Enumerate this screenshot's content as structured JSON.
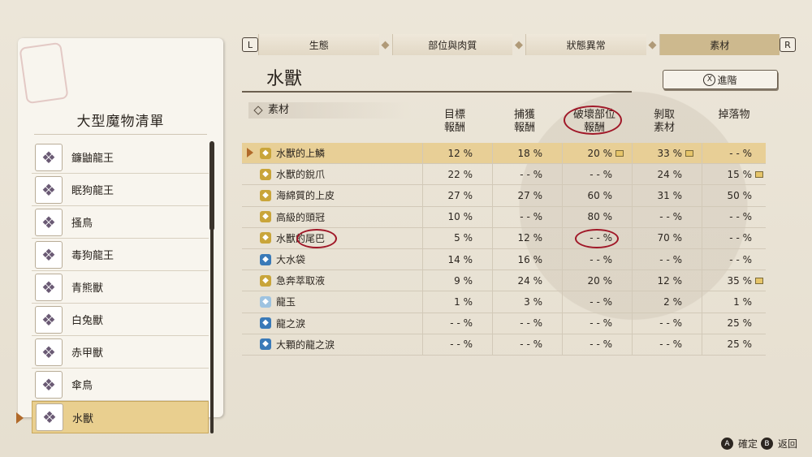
{
  "left_panel": {
    "title": "大型魔物清單",
    "monsters": [
      {
        "name": "鐮鼬龍王",
        "icon": "monster-portrait-icon"
      },
      {
        "name": "眠狗龍王",
        "icon": "monster-portrait-icon"
      },
      {
        "name": "搔鳥",
        "icon": "monster-portrait-icon"
      },
      {
        "name": "毒狗龍王",
        "icon": "monster-portrait-icon"
      },
      {
        "name": "青熊獸",
        "icon": "monster-portrait-icon"
      },
      {
        "name": "白兔獸",
        "icon": "monster-portrait-icon"
      },
      {
        "name": "赤甲獸",
        "icon": "monster-portrait-icon"
      },
      {
        "name": "傘鳥",
        "icon": "monster-portrait-icon"
      },
      {
        "name": "水獸",
        "icon": "monster-portrait-icon",
        "selected": true
      }
    ]
  },
  "tabs": {
    "left_key": "L",
    "right_key": "R",
    "items": [
      "生態",
      "部位與肉質",
      "狀態異常",
      "素材"
    ],
    "active": "素材"
  },
  "main": {
    "monster_name": "水獸",
    "advance_button": {
      "key": "X",
      "label": "進階"
    },
    "section": "素材",
    "columns": [
      {
        "line1": "目標",
        "line2": "報酬"
      },
      {
        "line1": "捕獲",
        "line2": "報酬"
      },
      {
        "line1": "破壞部位",
        "line2": "報酬"
      },
      {
        "line1": "剝取",
        "line2": "素材"
      },
      {
        "line1": "掉落物",
        "line2": ""
      }
    ],
    "rows": [
      {
        "name": "水獸的上鱗",
        "values": [
          "12 %",
          "18 %",
          "20 %",
          "33 %",
          "- - %"
        ],
        "multi": [
          false,
          false,
          true,
          true,
          false
        ],
        "color": "#c9a53a",
        "selected": true
      },
      {
        "name": "水獸的銳爪",
        "values": [
          "22 %",
          "- - %",
          "- - %",
          "24 %",
          "15 %"
        ],
        "multi": [
          false,
          false,
          false,
          false,
          true
        ],
        "color": "#c9a53a"
      },
      {
        "name": "海綿質的上皮",
        "values": [
          "27 %",
          "27 %",
          "60 %",
          "31 %",
          "50 %"
        ],
        "multi": [
          false,
          false,
          false,
          false,
          false
        ],
        "color": "#c9a53a"
      },
      {
        "name": "高級的頭冠",
        "values": [
          "10 %",
          "- - %",
          "80 %",
          "- - %",
          "- - %"
        ],
        "multi": [
          false,
          false,
          false,
          false,
          false
        ],
        "color": "#c9a53a"
      },
      {
        "name": "水獸的尾巴",
        "values": [
          "5 %",
          "12 %",
          "- - %",
          "70 %",
          "- - %"
        ],
        "multi": [
          false,
          false,
          false,
          false,
          false
        ],
        "color": "#c9a53a"
      },
      {
        "name": "大水袋",
        "values": [
          "14 %",
          "16 %",
          "- - %",
          "- - %",
          "- - %"
        ],
        "multi": [
          false,
          false,
          false,
          false,
          false
        ],
        "color": "#3a7ab8"
      },
      {
        "name": "急奔萃取液",
        "values": [
          "9 %",
          "24 %",
          "20 %",
          "12 %",
          "35 %"
        ],
        "multi": [
          false,
          false,
          false,
          false,
          true
        ],
        "color": "#c9a53a"
      },
      {
        "name": "龍玉",
        "values": [
          "1 %",
          "3 %",
          "- - %",
          "2 %",
          "1 %"
        ],
        "multi": [
          false,
          false,
          false,
          false,
          false
        ],
        "color": "#9ec3e0"
      },
      {
        "name": "龍之淚",
        "values": [
          "- - %",
          "- - %",
          "- - %",
          "- - %",
          "25 %"
        ],
        "multi": [
          false,
          false,
          false,
          false,
          false
        ],
        "color": "#3a7ab8"
      },
      {
        "name": "大顆的龍之淚",
        "values": [
          "- - %",
          "- - %",
          "- - %",
          "- - %",
          "25 %"
        ],
        "multi": [
          false,
          false,
          false,
          false,
          false
        ],
        "color": "#3a7ab8"
      }
    ]
  },
  "footer": {
    "confirm": {
      "key": "A",
      "label": "確定"
    },
    "back": {
      "key": "B",
      "label": "返回"
    }
  },
  "colors": {
    "highlight": "#e8cf96",
    "annotation": "#a01828"
  }
}
